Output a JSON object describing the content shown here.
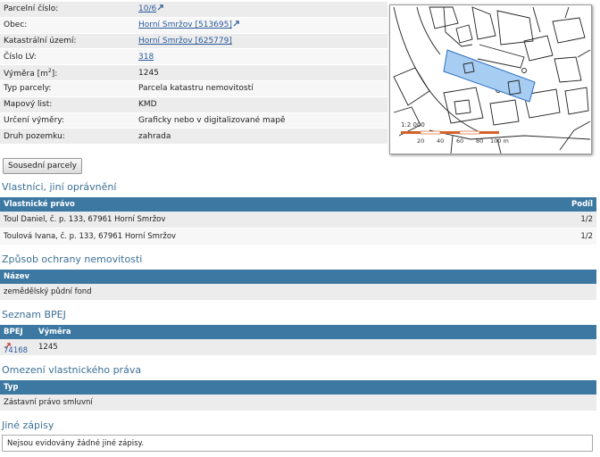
{
  "parcel": {
    "rows": [
      {
        "label": "Parcelní číslo:",
        "value": "10/6"
      },
      {
        "label": "Obec:",
        "value": "Horní Smržov [513695]"
      },
      {
        "label": "Katastrální území:",
        "value": "Horní Smržov [625779]"
      },
      {
        "label": "Číslo LV:",
        "value": "318"
      },
      {
        "label_prefix": "Výměra [m",
        "label_sup": "2",
        "label_suffix": "]:",
        "value": "1245"
      },
      {
        "label": "Typ parcely:",
        "value": "Parcela katastru nemovitostí"
      },
      {
        "label": "Mapový list:",
        "value": "KMD"
      },
      {
        "label": "Určení výměry:",
        "value": "Graficky nebo v digitalizované mapě"
      },
      {
        "label": "Druh pozemku:",
        "value": "zahrada"
      }
    ]
  },
  "map": {
    "scale_label": "1:2 000",
    "scale_ticks": [
      "20",
      "40",
      "60",
      "80",
      "100 m"
    ],
    "highlight_color": "#a8cdf2",
    "scale_color": "#d4622a"
  },
  "neighbors_button": "Sousední parcely",
  "owners": {
    "title": "Vlastníci, jiní oprávnění",
    "col_right": "Vlastnické právo",
    "col_share": "Podíl",
    "rows": [
      {
        "name": "Toul Daniel, č. p. 133, 67961 Horní Smržov",
        "share": "1/2"
      },
      {
        "name": "Toulová Ivana, č. p. 133, 67961 Horní Smržov",
        "share": "1/2"
      }
    ]
  },
  "protection": {
    "title": "Způsob ochrany nemovitosti",
    "col_name": "Název",
    "rows": [
      "zemědělský půdní fond"
    ]
  },
  "bpej": {
    "title": "Seznam BPEJ",
    "col_bpej": "BPEJ",
    "col_area": "Výměra",
    "rows": [
      {
        "code": "74168",
        "area": "1245"
      }
    ]
  },
  "restrictions": {
    "title": "Omezení vlastnického práva",
    "col_type": "Typ",
    "rows": [
      "Zástavní právo smluvní"
    ]
  },
  "other": {
    "title": "Jiné zápisy",
    "text": "Nejsou evidovány žádné jiné zápisy."
  },
  "colors": {
    "header_bar": "#3d78a2",
    "section_title": "#3a6f95",
    "link": "#2a5a9a"
  }
}
